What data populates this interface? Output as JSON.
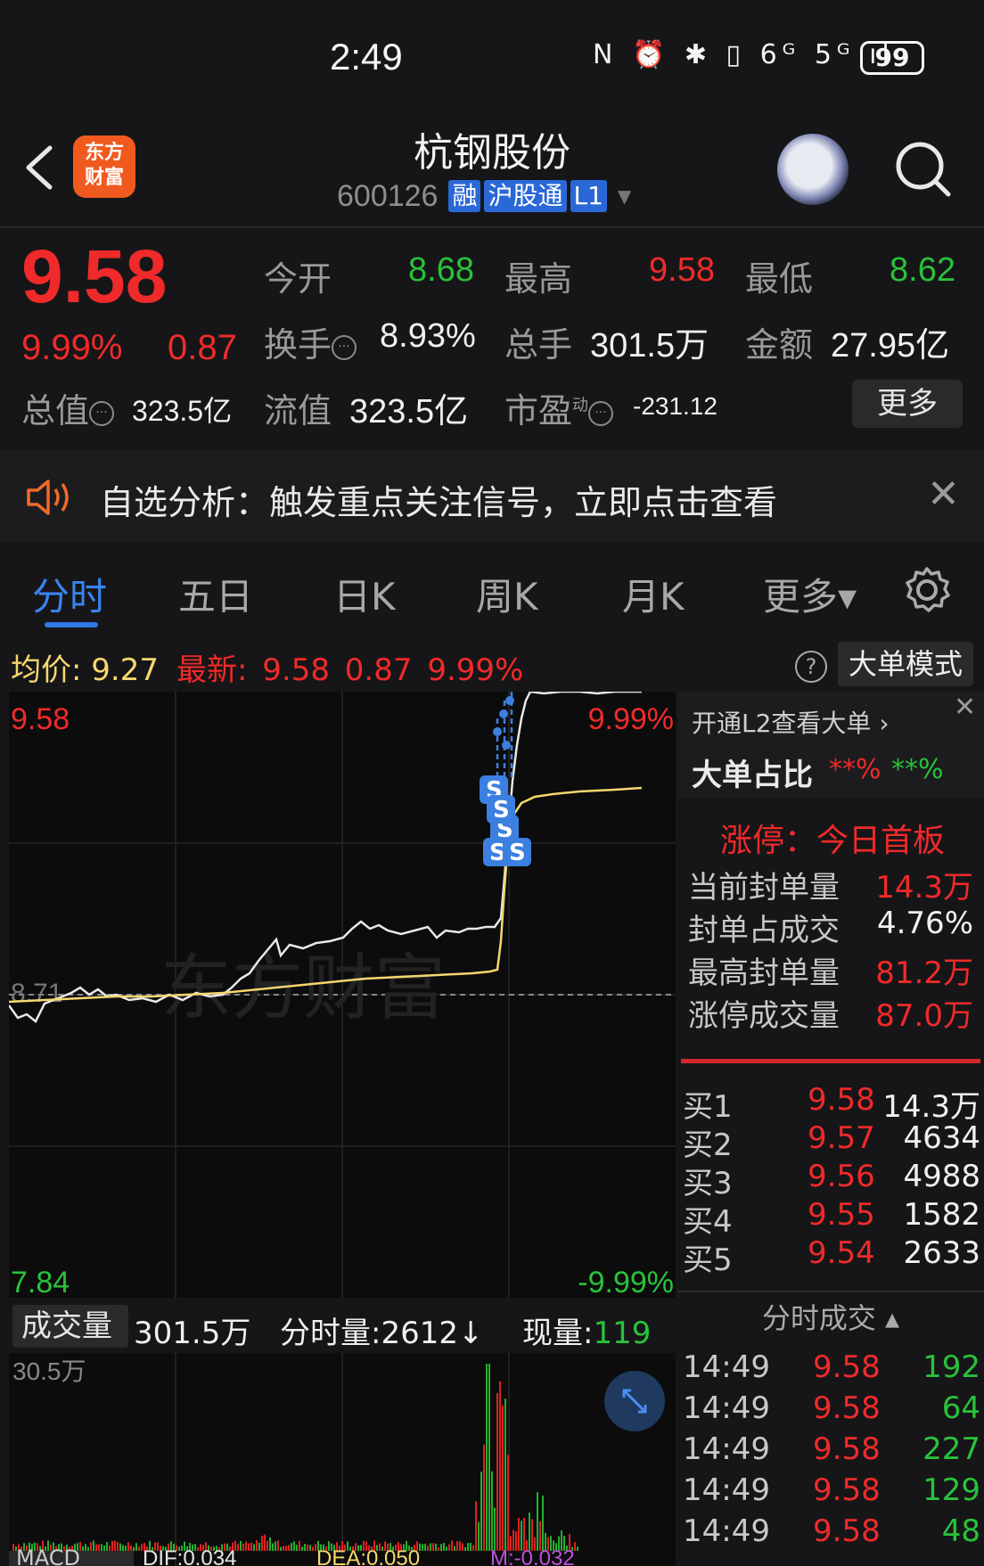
{
  "status": {
    "time": "2:49",
    "icons": "N ⏰ ✱ ▯ 6ᴳ 5ᴳ ıl",
    "battery": "99"
  },
  "header": {
    "title": "杭钢股份",
    "code": "600126",
    "tags": [
      "融",
      "沪股通",
      "L1"
    ],
    "logo": "东方财富"
  },
  "quote": {
    "price": "9.58",
    "change_pct": "9.99%",
    "change_amt": "0.87",
    "open_label": "今开",
    "open": "8.68",
    "high_label": "最高",
    "high": "9.58",
    "low_label": "最低",
    "low": "8.62",
    "turnover_label": "换手",
    "turnover": "8.93%",
    "volume_label": "总手",
    "volume": "301.5万",
    "amount_label": "金额",
    "amount": "27.95亿",
    "mktcap_label": "总值",
    "mktcap": "323.5亿",
    "float_label": "流值",
    "float": "323.5亿",
    "pe_label": "市盈",
    "pe_sup": "动",
    "pe": "-231.12",
    "more": "更多"
  },
  "notice": {
    "text": "自选分析：触发重点关注信号，立即点击查看"
  },
  "tabs": [
    "分时",
    "五日",
    "日K",
    "周K",
    "月K",
    "更多▾"
  ],
  "info_row": {
    "avg_label": "均价:",
    "avg": "9.27",
    "latest_label": "最新:",
    "latest": "9.58",
    "latest_chg": "0.87",
    "latest_pct": "9.99%",
    "mode_button": "大单模式"
  },
  "chart": {
    "y_top": "9.58",
    "y_bottom": "7.84",
    "pct_top": "9.99%",
    "pct_bottom": "-9.99%",
    "mid_label": "8.71",
    "watermark": "东方财富",
    "marker": "S"
  },
  "volume": {
    "selector": "成交量",
    "total": "301.5万",
    "min_vol_label": "分时量:2612↓",
    "now_label": "现量:",
    "now": "119",
    "max": "30.5万",
    "macd_label": "MACD",
    "dif": "DIF:0.034",
    "dea": "DEA:0.050",
    "m": "M:-0.032"
  },
  "right_panel": {
    "l2_link": "开通L2查看大单 ›",
    "big_order_label": "大单占比",
    "big_order_red": "**%",
    "big_order_green": "**%",
    "limit_title": "涨停：今日首板",
    "seal_rows": [
      {
        "label": "当前封单量",
        "value": "14.3万"
      },
      {
        "label": "封单占成交",
        "value": "4.76%"
      },
      {
        "label": "最高封单量",
        "value": "81.2万"
      },
      {
        "label": "涨停成交量",
        "value": "87.0万"
      }
    ],
    "bids": [
      {
        "label": "买1",
        "price": "9.58",
        "vol": "14.3万"
      },
      {
        "label": "买2",
        "price": "9.57",
        "vol": "4634"
      },
      {
        "label": "买3",
        "price": "9.56",
        "vol": "4988"
      },
      {
        "label": "买4",
        "price": "9.55",
        "vol": "1582"
      },
      {
        "label": "买5",
        "price": "9.54",
        "vol": "2633"
      }
    ],
    "ticks_header": "分时成交 ▴",
    "ticks": [
      {
        "time": "14:49",
        "price": "9.58",
        "vol": "192"
      },
      {
        "time": "14:49",
        "price": "9.58",
        "vol": "64"
      },
      {
        "time": "14:49",
        "price": "9.58",
        "vol": "227"
      },
      {
        "time": "14:49",
        "price": "9.58",
        "vol": "129"
      },
      {
        "time": "14:49",
        "price": "9.58",
        "vol": "48"
      }
    ]
  },
  "colors": {
    "up": "#f02a2a",
    "down": "#29c23a",
    "accent": "#2f78e6",
    "avg_line": "#f5d76e"
  }
}
